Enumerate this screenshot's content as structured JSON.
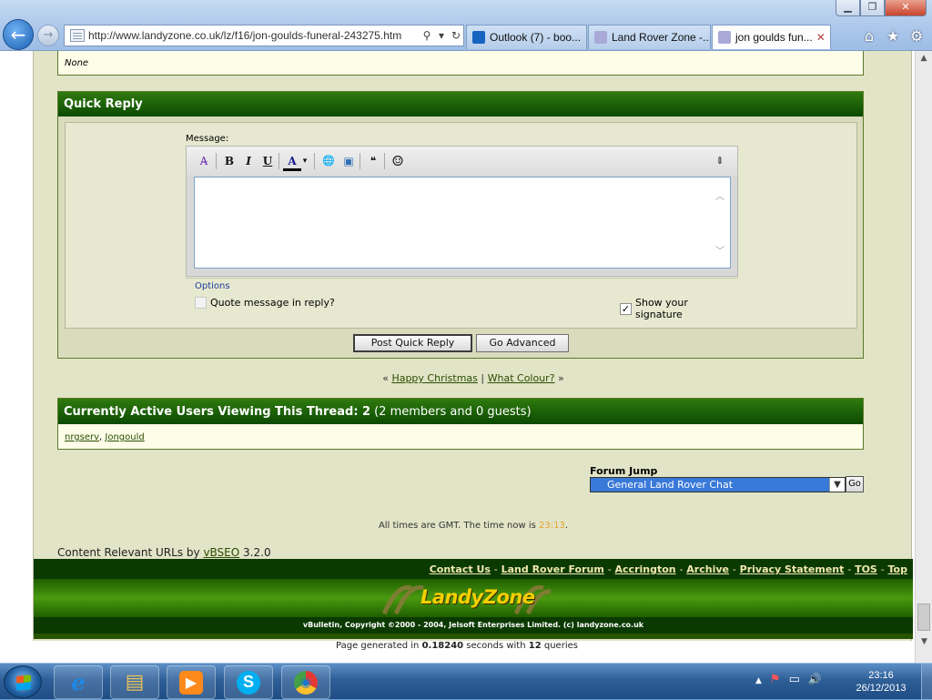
{
  "window": {
    "minimize_glyph": "▁",
    "maximize_glyph": "❐",
    "close_glyph": "✕"
  },
  "browser": {
    "back_glyph": "←",
    "forward_glyph": "→",
    "address": "http://www.landyzone.co.uk/lz/f16/jon-goulds-funeral-243275.htm",
    "tabs": [
      {
        "label": "Outlook (7) - boo...",
        "icon": "outlook-icon",
        "color": "#1565c0"
      },
      {
        "label": "Land Rover Zone -...",
        "icon": "landyzone-favicon",
        "color": "#8888cc"
      },
      {
        "label": "jon goulds fun...",
        "icon": "landyzone-favicon",
        "color": "#8888cc"
      }
    ],
    "tab_close": "✕",
    "toolbar_icons": [
      "home-icon",
      "favorites-icon",
      "tools-icon"
    ],
    "toolbar_glyphs": [
      "⌂",
      "★",
      "⚙"
    ]
  },
  "previous_post": {
    "text": "None"
  },
  "quick_reply": {
    "title": "Quick Reply",
    "message_label": "Message:",
    "toolbar": {
      "remove_format": "A̶",
      "bold": "B",
      "italic": "I",
      "underline": "U",
      "font_color": "A",
      "dropdown": "▾",
      "insert_link": "🌐",
      "insert_image": "▣",
      "quote": "❝",
      "smilie": "☺",
      "resize": "⇕"
    },
    "textarea_value": "",
    "options_legend": "Options",
    "quote_label": "Quote message in reply?",
    "quote_checked": false,
    "signature_label": "Show your signature",
    "signature_checked": true,
    "check_glyph": "✓",
    "post_button": "Post Quick Reply",
    "advanced_button": "Go Advanced"
  },
  "thread_nav": {
    "prev_arrow": "«",
    "prev": "Happy Christmas",
    "sep": "|",
    "next": "What Colour?",
    "next_arrow": "»"
  },
  "active_users": {
    "title": "Currently Active Users Viewing This Thread: 2",
    "detail": "(2 members and 0 guests)",
    "users": [
      "nrgserv",
      "Jongould"
    ],
    "user_sep": ","
  },
  "forum_jump": {
    "label": "Forum Jump",
    "selected": "General Land Rover Chat",
    "go": "Go"
  },
  "times": {
    "prefix": "All times are GMT. The time now is",
    "time": "23:13",
    "suffix": "."
  },
  "seq": {
    "prefix": "Content Relevant URLs by",
    "link": "vBSEO",
    "version": "3.2.0"
  },
  "footer": {
    "links": [
      "Contact Us",
      "Land Rover Forum",
      "Accrington",
      "Archive",
      "Privacy Statement",
      "TOS",
      "Top"
    ],
    "logo": "LandyZone",
    "copyright": "vBulletin, Copyright ©2000 - 2004, Jelsoft Enterprises Limited.   (c) landyzone.co.uk"
  },
  "page_generated": {
    "prefix": "Page generated in",
    "seconds": "0.18240",
    "middle": "seconds with",
    "queries": "12",
    "suffix": "queries"
  },
  "taskbar": {
    "apps": [
      {
        "name": "internet-explorer-icon",
        "glyph": "e",
        "color": "#1e88e5"
      },
      {
        "name": "file-explorer-icon",
        "glyph": "▤",
        "color": "#e8c25a"
      },
      {
        "name": "media-player-icon",
        "glyph": "▶",
        "color": "#ff8a1c"
      },
      {
        "name": "skype-icon",
        "glyph": "S",
        "color": "#00aff0"
      },
      {
        "name": "chrome-icon",
        "glyph": "◉",
        "color": "#e53935"
      }
    ],
    "tray_glyphs": [
      "▲",
      "⚑",
      "▭",
      "🔊"
    ],
    "clock_time": "23:16",
    "clock_date": "26/12/2013"
  }
}
